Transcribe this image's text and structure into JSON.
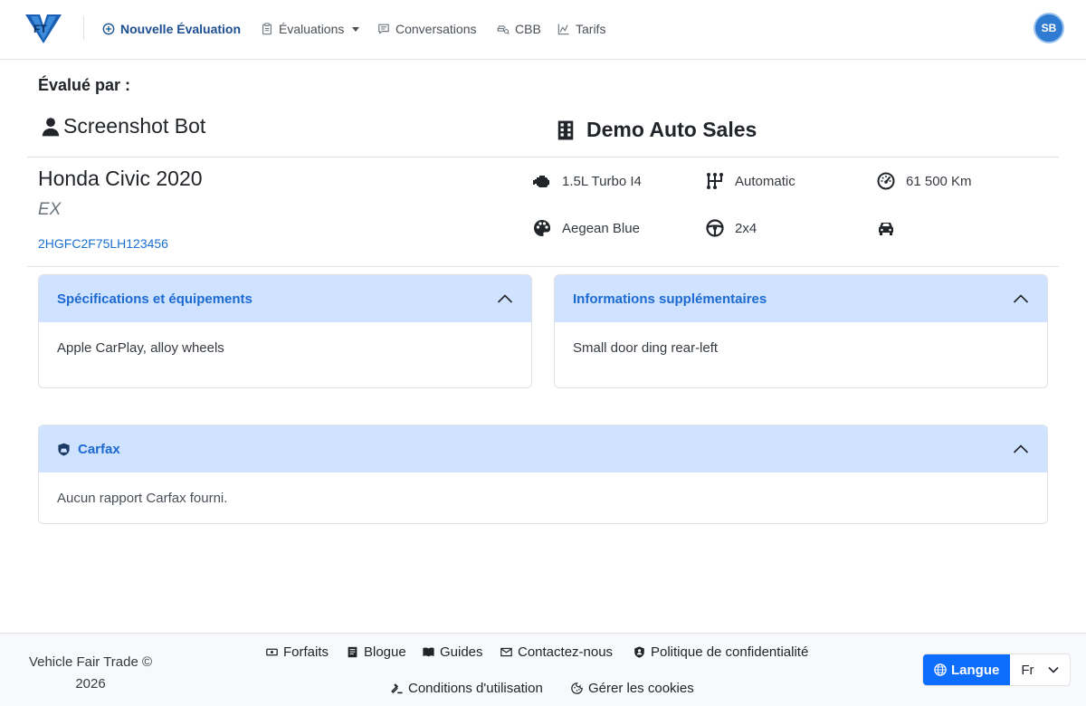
{
  "nav": {
    "items": [
      {
        "label": "Nouvelle Évaluation"
      },
      {
        "label": "Évaluations"
      },
      {
        "label": "Conversations"
      },
      {
        "label": "CBB"
      },
      {
        "label": "Tarifs"
      }
    ],
    "avatar_initials": "SB",
    "logo_text": "FT"
  },
  "evaluation": {
    "evaluated_by_label": "Évalué par :",
    "evaluator_name": "Screenshot Bot",
    "dealer_name": "Demo Auto Sales"
  },
  "vehicle": {
    "title": "Honda Civic 2020",
    "trim": "EX",
    "vin": "2HGFC2F75LH123456",
    "specs": {
      "engine": "1.5L Turbo I4",
      "transmission": "Automatic",
      "mileage": "61 500 Km",
      "color": "Aegean Blue",
      "drivetrain": "2x4",
      "body": ""
    }
  },
  "cards": {
    "specs_title": "Spécifications et équipements",
    "specs_body": "Apple CarPlay, alloy wheels",
    "info_title": "Informations supplémentaires",
    "info_body": "Small door ding rear-left",
    "carfax_title": "Carfax",
    "carfax_body": "Aucun rapport Carfax fourni."
  },
  "footer": {
    "copyright_line1": "Vehicle Fair Trade ©",
    "copyright_line2": "2026",
    "links": [
      {
        "label": "Forfaits"
      },
      {
        "label": "Blogue"
      },
      {
        "label": "Guides"
      },
      {
        "label": "Contactez-nous"
      },
      {
        "label": "Politique de confidentialité"
      },
      {
        "label": "Conditions d'utilisation"
      },
      {
        "label": "Gérer les cookies"
      }
    ],
    "language_button": "Langue",
    "language_value": "Fr"
  },
  "colors": {
    "primary": "#0d6efd",
    "nav_active": "#1d4f91",
    "card_header_bg": "#cfe2ff",
    "card_title": "#1d6ad1",
    "vin_link": "#1a6fd1",
    "avatar_bg": "#2f7bd2"
  },
  "icons": {
    "nav": [
      "plus-circle-icon",
      "clipboard-icon",
      "chat-icon",
      "car-search-icon",
      "chart-icon"
    ],
    "specs": [
      "engine-icon",
      "gearshift-icon",
      "speedometer-icon",
      "palette-icon",
      "steering-wheel-icon",
      "car-icon"
    ],
    "footer": [
      "ticket-icon",
      "blog-icon",
      "book-icon",
      "envelope-icon",
      "shield-person-icon",
      "gavel-icon",
      "cookie-icon",
      "globe-icon"
    ]
  }
}
